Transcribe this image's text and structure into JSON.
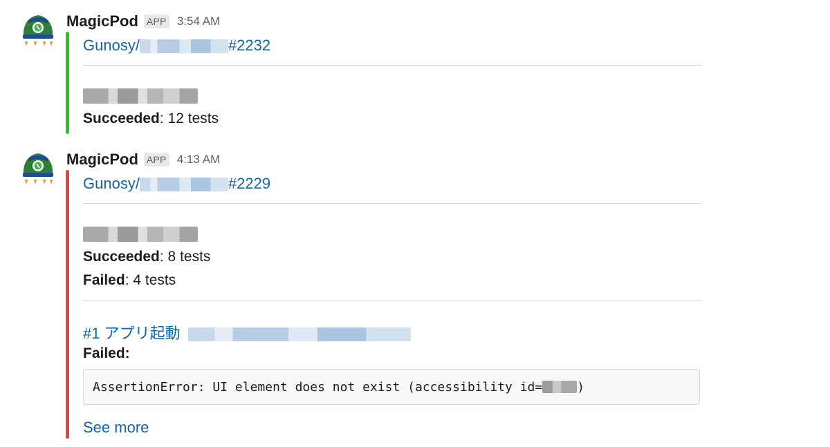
{
  "messages": [
    {
      "sender": "MagicPod",
      "badge": "APP",
      "time": "3:54 AM",
      "accent": "#2fbf2f",
      "link_prefix": "Gunosy/",
      "link_suffix": "#2232",
      "results": [
        {
          "label": "Succeeded",
          "value": ": 12 tests"
        }
      ]
    },
    {
      "sender": "MagicPod",
      "badge": "APP",
      "time": "4:13 AM",
      "accent": "#dd4444",
      "link_prefix": "Gunosy/",
      "link_suffix": "#2229",
      "results": [
        {
          "label": "Succeeded",
          "value": ": 8 tests"
        },
        {
          "label": "Failed",
          "value": ": 4 tests"
        }
      ],
      "failure": {
        "test_link": "#1 アプリ起動",
        "failed_label": "Failed:",
        "error_text": "AssertionError: UI element does not exist (accessibility id=",
        "error_close": ")",
        "see_more": "See more"
      }
    }
  ],
  "icons": {
    "avatar": "magicpod-rocket-icon"
  }
}
